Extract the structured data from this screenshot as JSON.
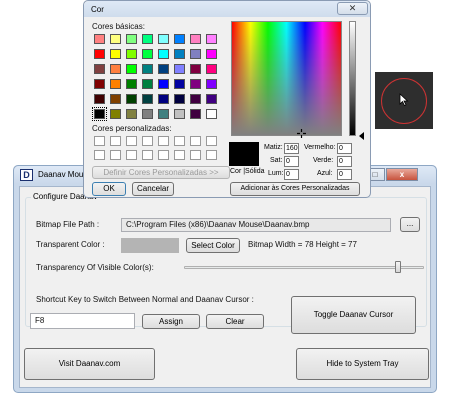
{
  "main_window": {
    "title": "Daanav Mouse by",
    "icon_letter": "D",
    "group_title": "Configure Daanav",
    "bitmap_label": "Bitmap File Path :",
    "bitmap_path": "C:\\Program Files (x86)\\Daanav Mouse\\Daanav.bmp",
    "browse_label": "...",
    "transparent_label": "Transparent Color :",
    "select_color_label": "Select Color",
    "bitmap_dims": "Bitmap Width = 78 Height = 77",
    "opacity_label": "Transparency Of Visible Color(s):",
    "shortcut_label": "Shortcut Key to Switch Between Normal and Daanav Cursor :",
    "shortcut_value": "F8",
    "assign_label": "Assign",
    "clear_label": "Clear",
    "toggle_label": "Toggle Daanav Cursor",
    "visit_label": "Visit Daanav.com",
    "hide_label": "Hide to System Tray",
    "opacity_level": 0.9,
    "min_glyph": "–",
    "max_glyph": "□",
    "close_glyph": "x"
  },
  "color_dialog": {
    "title": "Cor",
    "close_glyph": "✕",
    "basic_label": "Cores básicas:",
    "custom_label": "Cores personalizadas:",
    "define_custom_label": "Definir Cores Personalizadas >>",
    "ok_label": "OK",
    "cancel_label": "Cancelar",
    "add_custom_label": "Adicionar às Cores Personalizadas",
    "solid_label": "Cor |Sólida",
    "hue_label": "Matiz:",
    "sat_label": "Sat:",
    "lum_label": "Lum:",
    "red_label": "Vermelho:",
    "green_label": "Verde:",
    "blue_label": "Azul:",
    "hue": "160",
    "sat": "0",
    "lum": "0",
    "red": "0",
    "green": "0",
    "blue": "0",
    "basic_colors": [
      [
        "#ff8080",
        "#ffff80",
        "#80ff80",
        "#00ff80",
        "#80ffff",
        "#0080ff",
        "#ff80c0",
        "#ff80ff"
      ],
      [
        "#ff0000",
        "#ffff00",
        "#80ff00",
        "#00ff40",
        "#00ffff",
        "#0080c0",
        "#8080c0",
        "#ff00ff"
      ],
      [
        "#804040",
        "#ff8040",
        "#00ff00",
        "#008080",
        "#004080",
        "#8080ff",
        "#800040",
        "#ff0080"
      ],
      [
        "#800000",
        "#ff8000",
        "#008000",
        "#008040",
        "#0000ff",
        "#0000a0",
        "#800080",
        "#8000ff"
      ],
      [
        "#400000",
        "#804000",
        "#004000",
        "#004040",
        "#000080",
        "#000040",
        "#400040",
        "#400080"
      ],
      [
        "#000000",
        "#808000",
        "#808040",
        "#808080",
        "#408080",
        "#c0c0c0",
        "#400040",
        "#ffffff"
      ]
    ]
  },
  "preview": {
    "ring_color": "#cc3333"
  }
}
